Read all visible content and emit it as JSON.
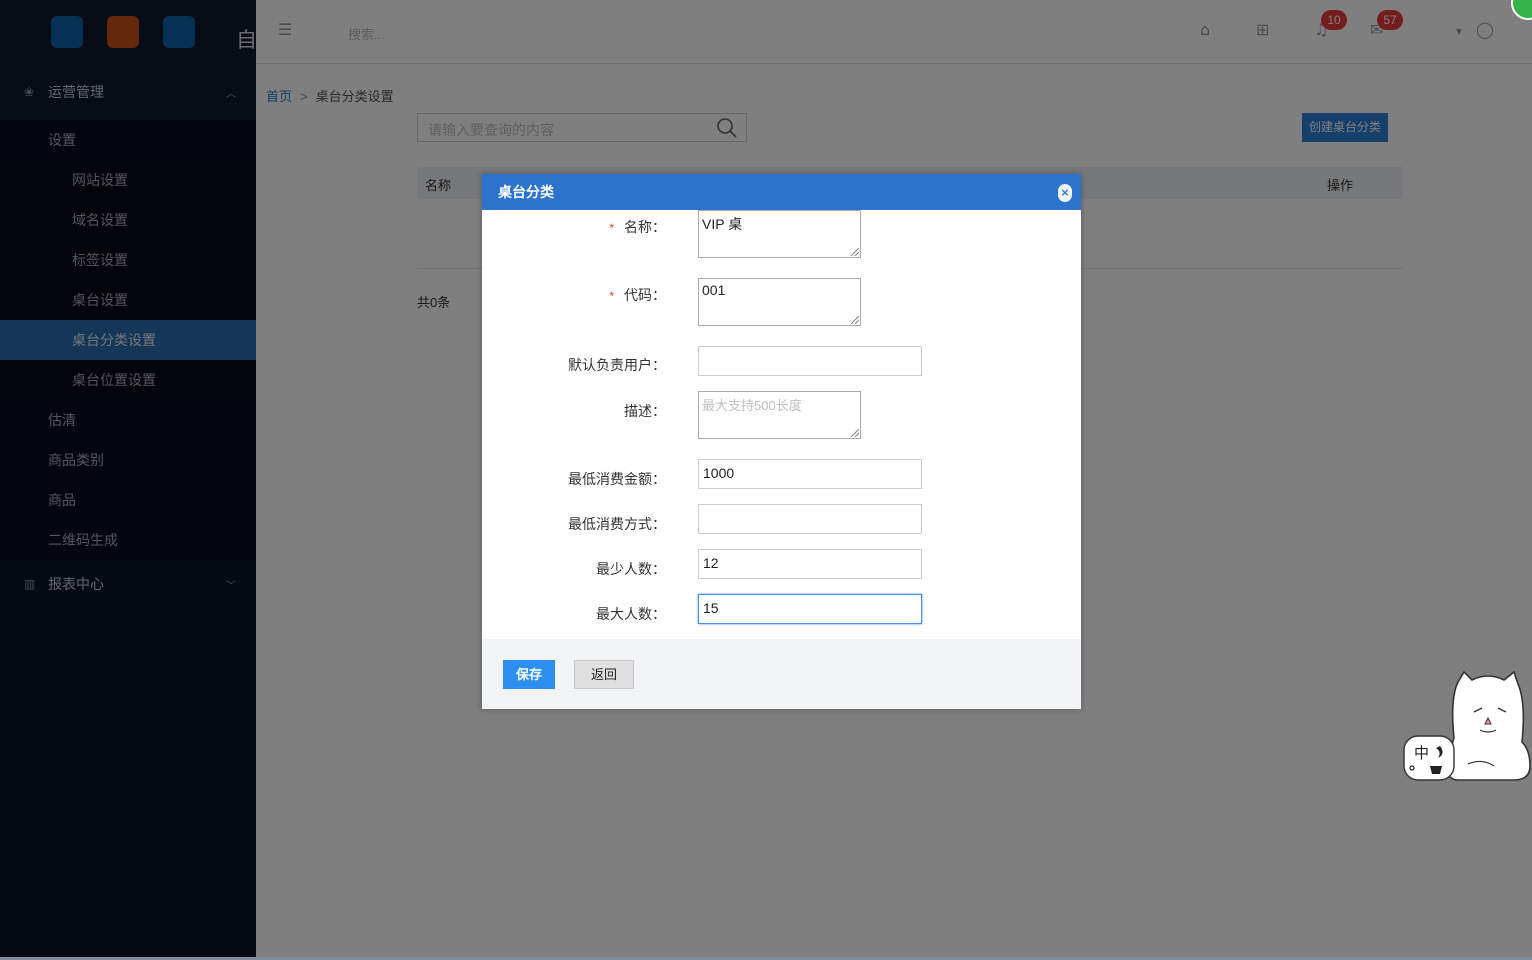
{
  "sidebar": {
    "logo_text": "自",
    "groups": [
      {
        "label": "运营管理",
        "expanded": true,
        "items": [
          {
            "label": "设置"
          },
          {
            "label": "网站设置"
          },
          {
            "label": "域名设置"
          },
          {
            "label": "标签设置"
          },
          {
            "label": "桌台设置"
          },
          {
            "label": "桌台分类设置"
          },
          {
            "label": "桌台位置设置"
          },
          {
            "label": "估清"
          },
          {
            "label": "商品类别"
          },
          {
            "label": "商品"
          },
          {
            "label": "二维码生成"
          }
        ]
      },
      {
        "label": "报表中心",
        "expanded": false
      }
    ]
  },
  "topbar": {
    "search_placeholder": "搜索...",
    "notifications_count": "10",
    "messages_count": "57"
  },
  "breadcrumb": {
    "home": "首页",
    "separator": ">",
    "current": "桌台分类设置"
  },
  "toolbar": {
    "query_placeholder": "请输入要查询的内容",
    "create_label": "创建桌台分类"
  },
  "table": {
    "columns": [
      "名称",
      "操作"
    ],
    "total_text": "共0条"
  },
  "modal": {
    "title": "桌台分类",
    "close_glyph": "×",
    "fields": {
      "name": {
        "label": "名称：",
        "required_mark": "*",
        "value": "VIP 桌"
      },
      "code": {
        "label": "代码：",
        "required_mark": "*",
        "value": "001"
      },
      "owner": {
        "label": "默认负责用户：",
        "value": ""
      },
      "description": {
        "label": "描述：",
        "placeholder": "最大支持500长度"
      },
      "min_amount": {
        "label": "最低消费金额：",
        "value": "1000"
      },
      "min_method": {
        "label": "最低消费方式：",
        "value": ""
      },
      "min_people": {
        "label": "最少人数：",
        "value": "12"
      },
      "max_people": {
        "label": "最大人数：",
        "value": "15"
      }
    },
    "save_label": "保存",
    "back_label": "返回"
  },
  "ime": {
    "mode_char": "中"
  },
  "colors": {
    "sidebar_bg": "#0a1627",
    "active_item": "#2c6cae",
    "modal_header": "#2b73cc",
    "primary_button": "#2d8ff0",
    "badge": "#e83a3a"
  }
}
